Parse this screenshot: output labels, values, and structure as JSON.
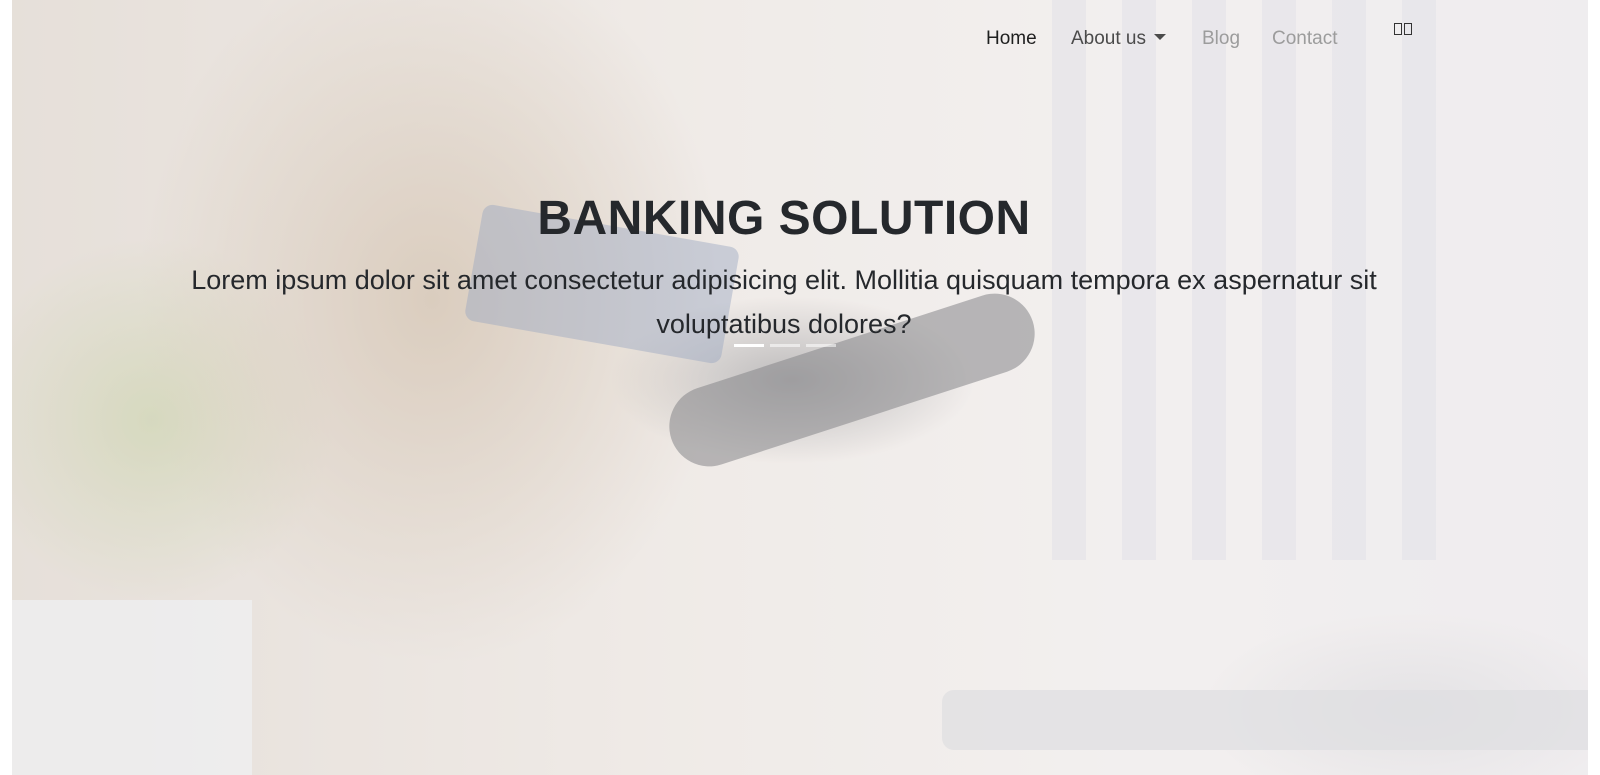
{
  "navbar": {
    "items": [
      {
        "label": "Home"
      },
      {
        "label": "About us"
      },
      {
        "label": "Blog"
      },
      {
        "label": "Contact"
      }
    ],
    "language_icon": "language-toggle-icon"
  },
  "hero": {
    "title": "BANKING SOLUTION",
    "subtitle": "Lorem ipsum dolor sit amet consectetur adipisicing elit. Mollitia quisquam tempora ex aspernatur sit voluptatibus dolores?",
    "slides_count": 3,
    "active_slide": 1
  },
  "colors": {
    "text_dark": "#25282c",
    "nav_active": "#1f1f1f",
    "nav_muted": "#9c9c9c",
    "indicator_active": "#ffffff"
  }
}
